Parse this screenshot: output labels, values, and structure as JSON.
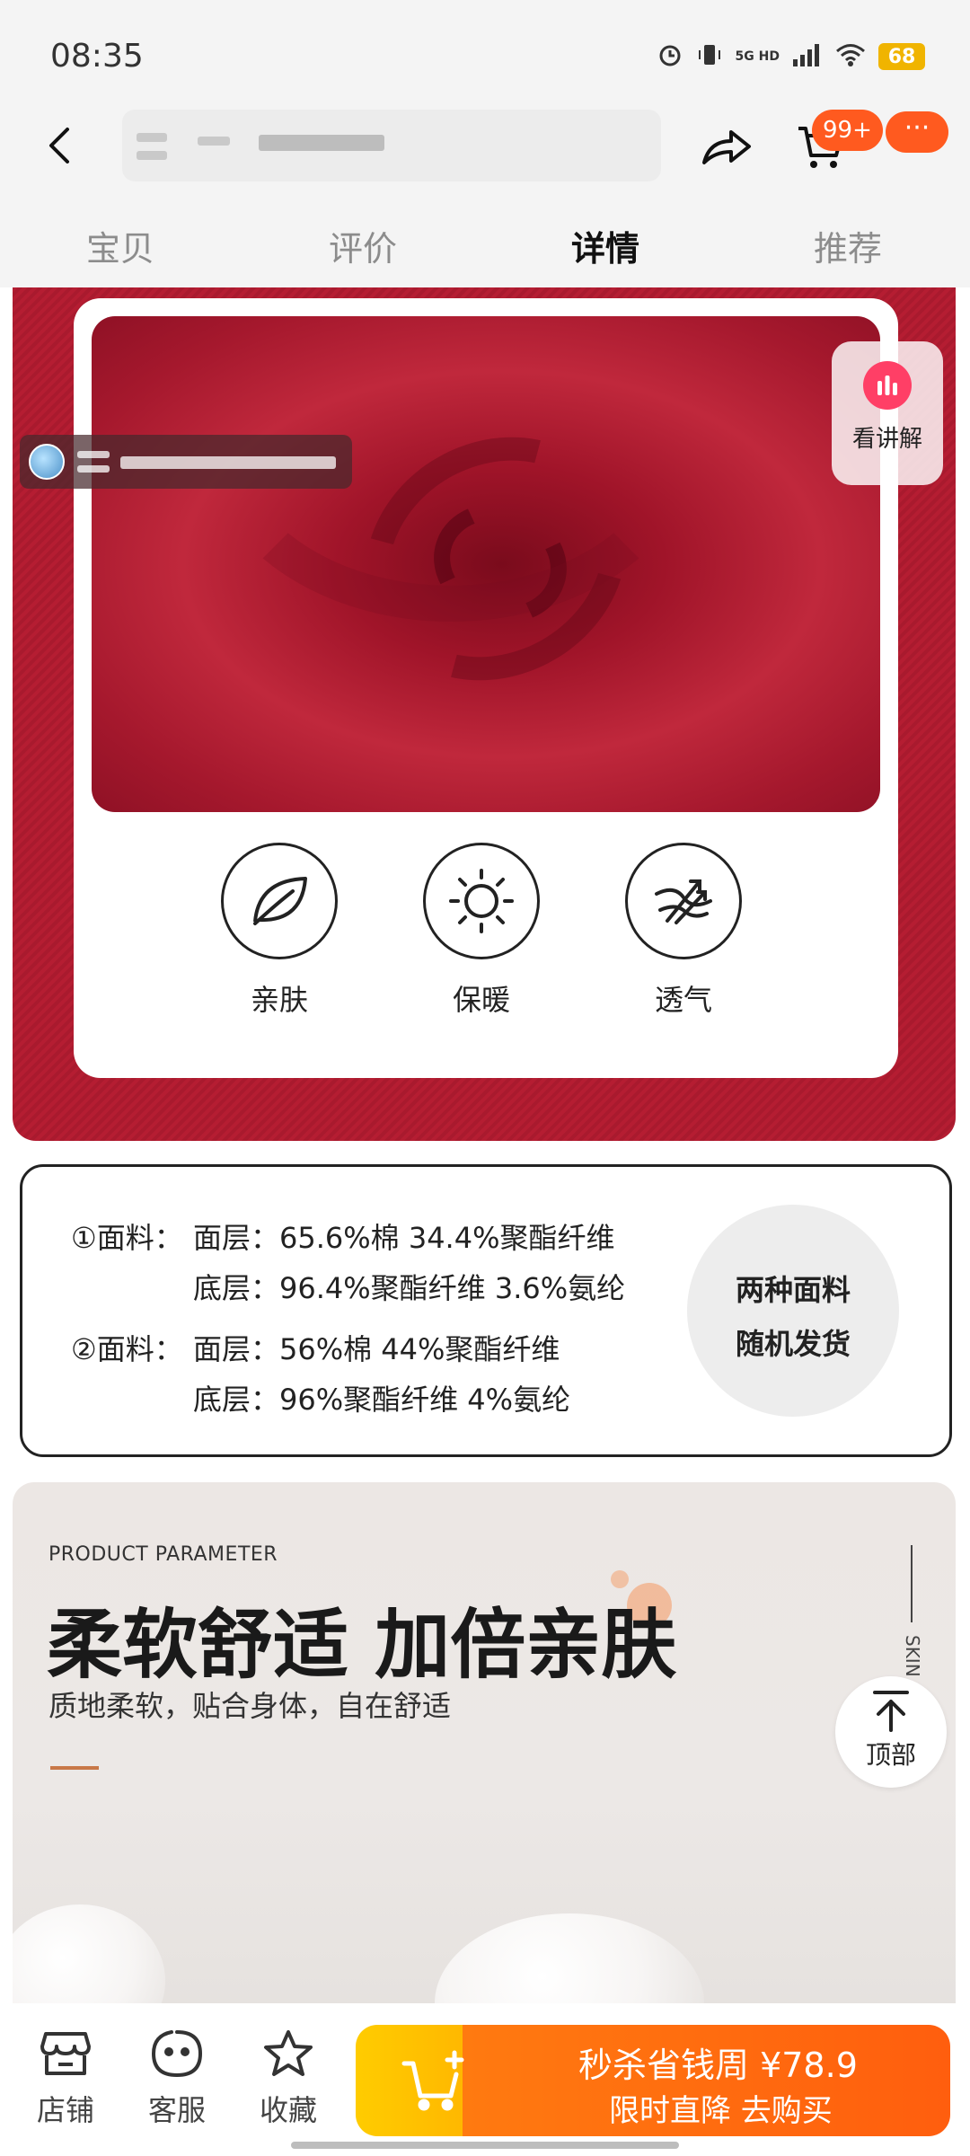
{
  "status_bar": {
    "time": "08:35",
    "network": "5G HD",
    "battery": "68",
    "icons": [
      "alarm-icon",
      "vibrate-icon",
      "signal-icon",
      "wifi-icon",
      "battery-icon"
    ]
  },
  "header": {
    "back_icon": "chevron-left-icon",
    "share_icon": "share-icon",
    "cart_icon": "cart-icon",
    "cart_badge": "99+",
    "more_label": "···"
  },
  "tabs": [
    {
      "label": "宝贝",
      "active": false
    },
    {
      "label": "评价",
      "active": false
    },
    {
      "label": "详情",
      "active": true
    },
    {
      "label": "推荐",
      "active": false
    }
  ],
  "live": {
    "watch_label": "看讲解"
  },
  "features": [
    {
      "label": "亲肤",
      "icon": "leaf-icon"
    },
    {
      "label": "保暖",
      "icon": "sun-icon"
    },
    {
      "label": "透气",
      "icon": "airflow-icon"
    }
  ],
  "composition": {
    "line1": "①面料：",
    "line1_value": "面层：65.6%棉 34.4%聚酯纤维",
    "line2_value": "底层：96.4%聚酯纤维 3.6%氨纶",
    "line3": "②面料：",
    "line3_value": "面层：56%棉 44%聚酯纤维",
    "line4_value": "底层：96%聚酯纤维 4%氨纶",
    "badge_line1": "两种面料",
    "badge_line2": "随机发货"
  },
  "parameter": {
    "eyebrow": "PRODUCT PARAMETER",
    "title": "柔软舒适 加倍亲肤",
    "subtitle": "质地柔软，贴合身体，自在舒适",
    "side_text": "SKIN"
  },
  "top_button": {
    "label": "顶部"
  },
  "bottom_bar": {
    "store_label": "店铺",
    "service_label": "客服",
    "favorite_label": "收藏",
    "buy_line1": "秒杀省钱周 ¥78.9",
    "buy_line2": "限时直降 去购买"
  },
  "colors": {
    "accent_orange": "#ff5a1f",
    "fabric_red": "#b51d32",
    "watch_pink": "#ff3f66",
    "buy_yellow": "#ffcc00"
  }
}
